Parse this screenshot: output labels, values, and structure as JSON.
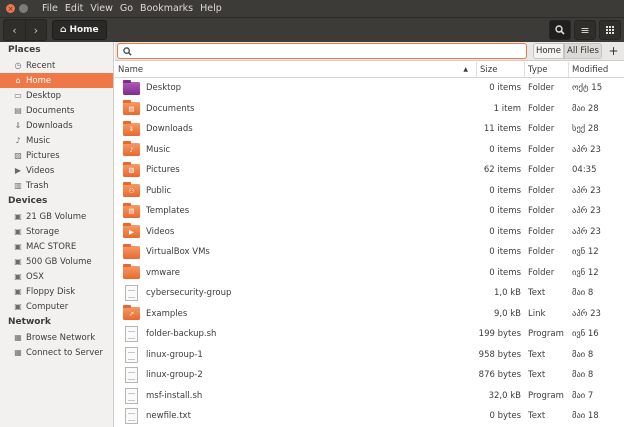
{
  "menubar": {
    "menus": [
      "File",
      "Edit",
      "View",
      "Go",
      "Bookmarks",
      "Help"
    ]
  },
  "toolbar": {
    "back_icon": "‹",
    "forward_icon": "›",
    "path_home_label": "Home",
    "search_icon": "🔍",
    "list_view_icon": "≡",
    "grid_view_icon": "⋮⋮"
  },
  "sidebar": {
    "places_header": "Places",
    "places": [
      {
        "label": "Recent",
        "icon": "◷",
        "name": "recent"
      },
      {
        "label": "Home",
        "icon": "⌂",
        "name": "home",
        "active": true
      },
      {
        "label": "Desktop",
        "icon": "▭",
        "name": "desktop"
      },
      {
        "label": "Documents",
        "icon": "▤",
        "name": "documents"
      },
      {
        "label": "Downloads",
        "icon": "⇓",
        "name": "downloads"
      },
      {
        "label": "Music",
        "icon": "♪",
        "name": "music"
      },
      {
        "label": "Pictures",
        "icon": "▨",
        "name": "pictures"
      },
      {
        "label": "Videos",
        "icon": "▶",
        "name": "videos"
      },
      {
        "label": "Trash",
        "icon": "▥",
        "name": "trash"
      }
    ],
    "devices_header": "Devices",
    "devices": [
      {
        "label": "21 GB Volume",
        "icon": "▣"
      },
      {
        "label": "Storage",
        "icon": "▣"
      },
      {
        "label": "MAC STORE",
        "icon": "▣"
      },
      {
        "label": "500 GB Volume",
        "icon": "▣"
      },
      {
        "label": "OSX",
        "icon": "▣"
      },
      {
        "label": "Floppy Disk",
        "icon": "▣"
      },
      {
        "label": "Computer",
        "icon": "▣"
      }
    ],
    "network_header": "Network",
    "network": [
      {
        "label": "Browse Network",
        "icon": "▦"
      },
      {
        "label": "Connect to Server",
        "icon": "▦"
      }
    ]
  },
  "search": {
    "placeholder": "",
    "scope_home": "Home",
    "scope_all": "All Files",
    "add_label": "+"
  },
  "columns": {
    "name": "Name",
    "size": "Size",
    "type": "Type",
    "modified": "Modified",
    "sort_indicator": "▲"
  },
  "files": [
    {
      "name": "Desktop",
      "size": "0 items",
      "type": "Folder",
      "modified": "ოქტ 15",
      "kind": "folder",
      "variant": "desktop",
      "emblem": ""
    },
    {
      "name": "Documents",
      "size": "1 item",
      "type": "Folder",
      "modified": "მაი 28",
      "kind": "folder",
      "emblem": "▤"
    },
    {
      "name": "Downloads",
      "size": "11 items",
      "type": "Folder",
      "modified": "სექ 28",
      "kind": "folder",
      "emblem": "⇓"
    },
    {
      "name": "Music",
      "size": "0 items",
      "type": "Folder",
      "modified": "აპრ 23",
      "kind": "folder",
      "emblem": "♪"
    },
    {
      "name": "Pictures",
      "size": "62 items",
      "type": "Folder",
      "modified": "04:35",
      "kind": "folder",
      "emblem": "▨"
    },
    {
      "name": "Public",
      "size": "0 items",
      "type": "Folder",
      "modified": "აპრ 23",
      "kind": "folder",
      "emblem": "⚇"
    },
    {
      "name": "Templates",
      "size": "0 items",
      "type": "Folder",
      "modified": "აპრ 23",
      "kind": "folder",
      "emblem": "▤"
    },
    {
      "name": "Videos",
      "size": "0 items",
      "type": "Folder",
      "modified": "აპრ 23",
      "kind": "folder",
      "emblem": "▶"
    },
    {
      "name": "VirtualBox VMs",
      "size": "0 items",
      "type": "Folder",
      "modified": "ივნ 12",
      "kind": "folder",
      "emblem": ""
    },
    {
      "name": "vmware",
      "size": "0 items",
      "type": "Folder",
      "modified": "ივნ 12",
      "kind": "folder",
      "emblem": ""
    },
    {
      "name": "cybersecurity-group",
      "size": "1,0 kB",
      "type": "Text",
      "modified": "მაი 8",
      "kind": "doc"
    },
    {
      "name": "Examples",
      "size": "9,0 kB",
      "type": "Link",
      "modified": "აპრ 23",
      "kind": "folder",
      "emblem": "↗"
    },
    {
      "name": "folder-backup.sh",
      "size": "199 bytes",
      "type": "Program",
      "modified": "ივნ 16",
      "kind": "doc"
    },
    {
      "name": "linux-group-1",
      "size": "958 bytes",
      "type": "Text",
      "modified": "მაი 8",
      "kind": "doc"
    },
    {
      "name": "linux-group-2",
      "size": "876 bytes",
      "type": "Text",
      "modified": "მაი 8",
      "kind": "doc"
    },
    {
      "name": "msf-install.sh",
      "size": "32,0 kB",
      "type": "Program",
      "modified": "მაი 7",
      "kind": "doc"
    },
    {
      "name": "newfile.txt",
      "size": "0 bytes",
      "type": "Text",
      "modified": "მაი 18",
      "kind": "doc"
    }
  ]
}
